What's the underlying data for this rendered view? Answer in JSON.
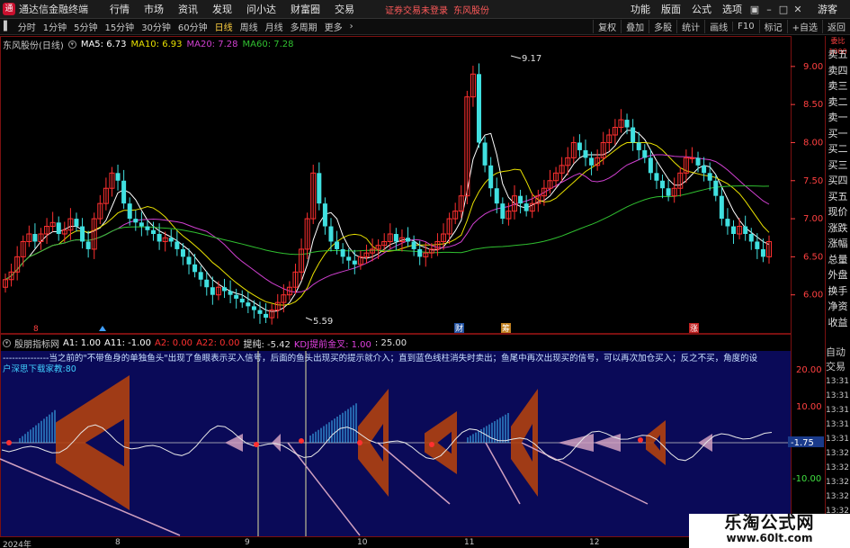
{
  "menubar": {
    "app_title": "通达信金融终端",
    "items": [
      "行情",
      "市场",
      "资讯",
      "发现",
      "问小达",
      "财富圈",
      "交易"
    ],
    "notice": "证券交易未登录",
    "stock": "东风股份",
    "right_items": [
      "功能",
      "版面",
      "公式",
      "选项"
    ],
    "guest": "游客"
  },
  "toolbar": {
    "periods": [
      "分时",
      "1分钟",
      "5分钟",
      "15分钟",
      "30分钟",
      "60分钟",
      "日线",
      "周线",
      "月线",
      "多周期",
      "更多"
    ],
    "active_period": "日线",
    "right_items": [
      "复权",
      "叠加",
      "多股",
      "统计",
      "画线",
      "F10",
      "标记",
      "+自选",
      "返回"
    ]
  },
  "main_legend": {
    "stock_label": "东风股份(日线)",
    "ma5": "MA5: 6.73",
    "ma10": "MA10: 6.93",
    "ma20": "MA20: 7.28",
    "ma60": "MA60: 7.28"
  },
  "colors": {
    "ma5": "#ffffff",
    "ma10": "#e8e000",
    "ma20": "#d040d0",
    "ma60": "#30c030",
    "up": "#ff3030",
    "down": "#40e0e0",
    "frame": "#7a1010",
    "fish_fill": "#b04010",
    "fish_light": "#d0a0c0",
    "panel_bg": "#0a0a58"
  },
  "price_axis": {
    "labels": [
      "9.00",
      "8.50",
      "8.00",
      "7.50",
      "7.00",
      "6.50",
      "6.00"
    ],
    "values": [
      9.0,
      8.5,
      8.0,
      7.5,
      7.0,
      6.5,
      6.0
    ],
    "high_marker": "9.17",
    "low_marker": "5.59"
  },
  "event_markers": {
    "left_mark": "8",
    "cai": "财",
    "chou": "筹",
    "zhang": "涨"
  },
  "indicator_legend": {
    "name": "殷朋指标网",
    "a1": "A1: 1.00",
    "a11": "A11: -1.00",
    "a2": "A2: 0.00",
    "a22": "A22: 0.00",
    "tichun": "提纯: -5.42",
    "kdj": "KDJ提前金叉: 1.00",
    "v25": ": 25.00"
  },
  "indicator_text": {
    "scroll": "---------------当之前的\"不带鱼身的单独鱼头\"出现了鱼眼表示买入信号，后面的鱼头出现买的提示就介入；直到蓝色线柱消失时卖出；鱼尾中再次出现买的信号，可以再次加仓买入；反之不买，角度的设",
    "line2": "户深思下载家教:80"
  },
  "indicator_axis": {
    "labels": [
      "20.00",
      "10.00",
      "-10.00"
    ],
    "current": "-1.75"
  },
  "side_panel": {
    "header": "委比1000",
    "items": [
      "委比",
      "卖五",
      "卖四",
      "卖三",
      "卖二",
      "卖一",
      "买一",
      "买二",
      "买三",
      "买四",
      "买五",
      "现价",
      "涨跌",
      "涨幅",
      "总量",
      "外盘",
      "换手",
      "净资",
      "收益"
    ],
    "lower_items": [
      "自动",
      "交易",
      "13:31",
      "13:31",
      "13:31",
      "13:31",
      "13:31",
      "13:32",
      "13:32",
      "13:32",
      "13:32",
      "13:32",
      "13:32"
    ]
  },
  "date_axis": {
    "labels": [
      "2024年",
      "8",
      "9",
      "10",
      "11",
      "12"
    ]
  },
  "watermark": {
    "line1": "乐淘公式网",
    "line2": "www.60lt.com"
  },
  "chart_data": {
    "type": "candlestick",
    "title": "",
    "series": [
      {
        "name": "MA5",
        "value": 6.73
      },
      {
        "name": "MA10",
        "value": 6.93
      },
      {
        "name": "MA20",
        "value": 7.28
      },
      {
        "name": "MA60",
        "value": 7.28
      }
    ],
    "ylim": [
      5.5,
      9.4
    ],
    "high": 9.17,
    "low": 5.59,
    "close_approx": [
      6.2,
      6.3,
      6.5,
      6.7,
      6.8,
      6.7,
      6.8,
      6.9,
      6.95,
      6.8,
      6.85,
      7.0,
      6.9,
      6.7,
      6.6,
      7.0,
      7.2,
      7.4,
      7.6,
      7.5,
      7.2,
      7.0,
      6.95,
      6.9,
      6.85,
      6.8,
      6.7,
      6.75,
      6.7,
      6.6,
      6.5,
      6.4,
      6.3,
      6.2,
      6.1,
      6.0,
      6.1,
      6.05,
      6.0,
      5.95,
      5.9,
      5.85,
      5.8,
      5.75,
      5.7,
      5.8,
      5.9,
      6.0,
      6.1,
      6.3,
      6.6,
      7.0,
      7.6,
      7.2,
      6.9,
      6.7,
      6.6,
      6.5,
      6.45,
      6.4,
      6.5,
      6.55,
      6.6,
      6.65,
      6.7,
      6.8,
      6.7,
      6.75,
      6.7,
      6.6,
      6.5,
      6.55,
      6.6,
      6.7,
      6.8,
      7.0,
      7.1,
      7.3,
      8.6,
      8.9,
      8.0,
      7.7,
      7.4,
      7.2,
      7.0,
      7.1,
      7.3,
      7.2,
      7.1,
      7.2,
      7.3,
      7.4,
      7.5,
      7.6,
      7.7,
      7.8,
      8.0,
      7.9,
      7.8,
      7.7,
      7.8,
      8.0,
      8.1,
      8.2,
      8.3,
      8.2,
      8.0,
      7.9,
      7.8,
      7.6,
      7.5,
      7.4,
      7.3,
      7.4,
      7.6,
      7.8,
      7.8,
      7.7,
      7.6,
      7.5,
      7.3,
      7.0,
      6.9,
      6.8,
      6.9,
      6.8,
      6.7,
      6.6,
      6.5,
      6.7
    ]
  }
}
